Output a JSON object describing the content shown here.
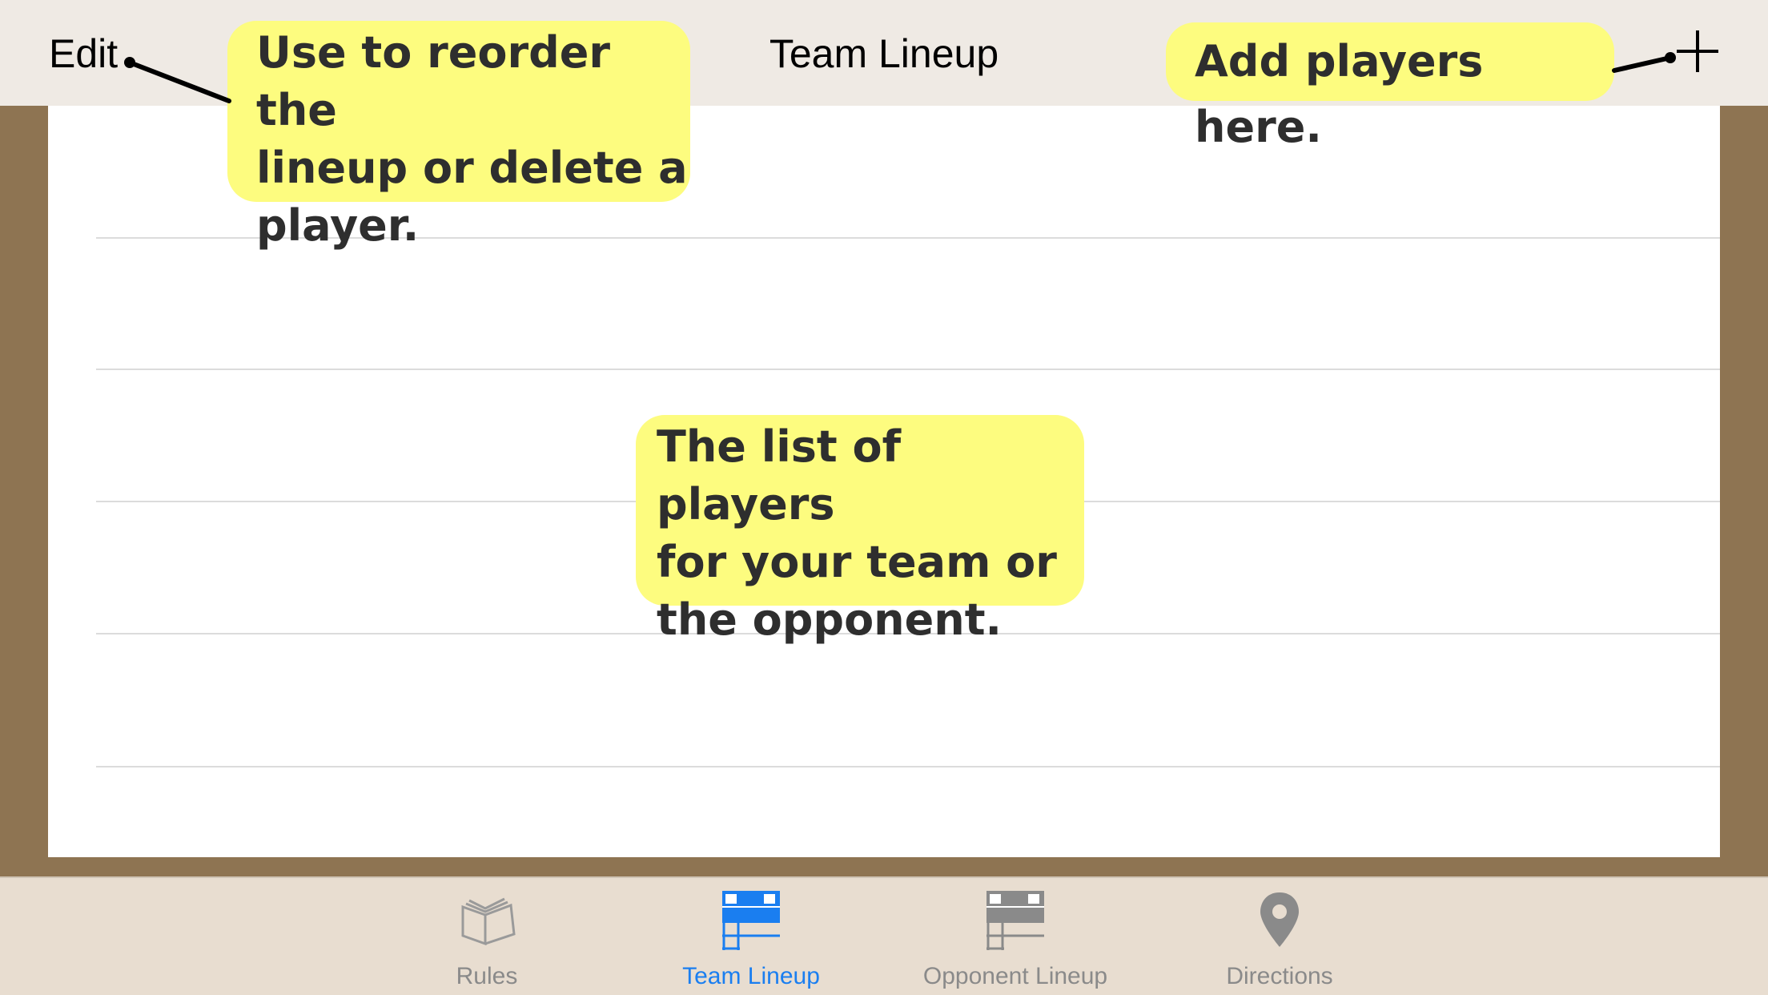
{
  "navbar": {
    "edit_label": "Edit",
    "title": "Team Lineup",
    "add_icon": "plus-icon"
  },
  "callouts": {
    "edit": "Use to reorder the\nlineup or delete a\nplayer.",
    "add": "Add players here.",
    "list": "The list of players\nfor your team or\nthe opponent."
  },
  "tabbar": {
    "tabs": [
      {
        "label": "Rules",
        "icon": "book-icon"
      },
      {
        "label": "Team Lineup",
        "icon": "lineup-card-icon"
      },
      {
        "label": "Opponent Lineup",
        "icon": "lineup-card-icon"
      },
      {
        "label": "Directions",
        "icon": "map-pin-icon"
      }
    ],
    "active_index": 1
  },
  "colors": {
    "accent": "#1a7ef0",
    "inactive": "#8a8a8a",
    "callout": "#fdfc7f",
    "frame": "#8e7452"
  }
}
